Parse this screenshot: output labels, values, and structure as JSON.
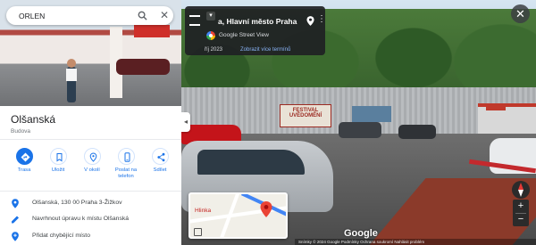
{
  "search": {
    "value": "ORLEN",
    "search_icon": "search-icon",
    "close_icon": "close-icon"
  },
  "place": {
    "name": "Olšanská",
    "type": "Budova"
  },
  "actions": [
    {
      "label": "Trasa",
      "icon": "directions-icon",
      "primary": true
    },
    {
      "label": "Uložit",
      "icon": "bookmark-icon",
      "primary": false
    },
    {
      "label": "V okolí",
      "icon": "nearby-icon",
      "primary": false
    },
    {
      "label": "Poslat na telefon",
      "icon": "send-to-phone-icon",
      "primary": false
    },
    {
      "label": "Sdílet",
      "icon": "share-icon",
      "primary": false
    }
  ],
  "info": [
    {
      "text": "Olšanská, 130 00 Praha 3-Žižkov",
      "icon": "location-pin-icon"
    },
    {
      "text": "Navrhnout úpravu k místu Olšanská",
      "icon": "edit-icon"
    },
    {
      "text": "Přidat chybějící místo",
      "icon": "add-place-icon"
    }
  ],
  "street_view": {
    "title": "a, Hlavní město Praha",
    "subtitle": "Google Street View",
    "date": "říj 2023",
    "see_more": "Zobrazit více termínů",
    "watermark": "Google",
    "footer": "Snímky © 2024 Google    Podmínky    Ochrana soukromí    Nahlásit problém",
    "banner_text": "FESTIVAL UVĚDOMĚNÍ",
    "minimap_label": "Hlinka"
  },
  "colors": {
    "accent": "#1a73e8",
    "pin_red": "#ea4335",
    "card_bg": "#202124"
  }
}
